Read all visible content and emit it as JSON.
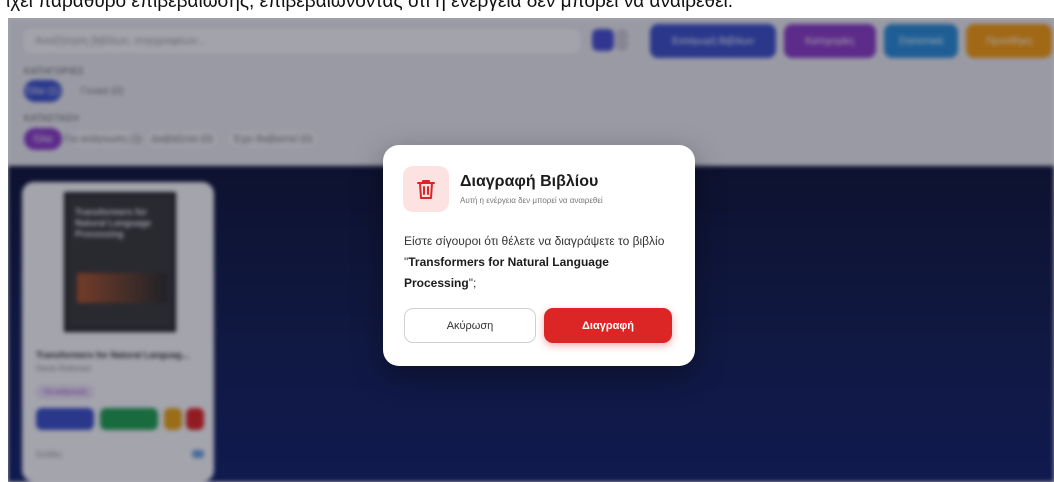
{
  "caption": "ιχει παράθυρο επιβεβαίωσης, επιβεβαιώνοντας ότι η ενέργεια δεν μπορεί να αναιρεθεί.",
  "toolbar": {
    "search_placeholder": "Αναζήτηση βιβλίων, συγγραφέων...",
    "buttons": [
      "Εισαγωγή Βιβλίων",
      "Κατηγορίες",
      "Στατιστικά",
      "Προσθήκη"
    ],
    "category_label": "ΚΑΤΗΓΟΡΙΕΣ",
    "category_chips": [
      "Όλα (1)",
      "Γενικά (0)"
    ],
    "status_label": "ΚΑΤΑΣΤΑΣΗ",
    "status_chips": [
      "Όλα",
      "Για ανάγνωση (1)",
      "Διαβάζεται (0)",
      "Έχει διαβαστεί (0)"
    ]
  },
  "book_card": {
    "cover_title": "Transformers for Natural Language Processing",
    "title": "Transformers for Natural Languag...",
    "author": "Denis Rothman",
    "tag": "Για ανάγνωση",
    "footer_label": "Σελίδες"
  },
  "modal": {
    "title": "Διαγραφή Βιβλίου",
    "subtitle": "Αυτή η ενέργεια δεν μπορεί να αναιρεθεί",
    "body_prefix": "Είστε σίγουροι ότι θέλετε να διαγράψετε το βιβλίο \"",
    "book_name": "Transformers for Natural Language Processing",
    "body_suffix": "\";",
    "cancel_label": "Ακύρωση",
    "delete_label": "Διαγραφή",
    "icon": "trash-icon"
  },
  "colors": {
    "danger": "#dc2626",
    "danger_soft": "#fde2e2",
    "primary": "#3c51c7",
    "purple": "#8a3ec4",
    "teal": "#2a8dd6",
    "orange": "#f39c12",
    "background_dark": "#142257"
  }
}
